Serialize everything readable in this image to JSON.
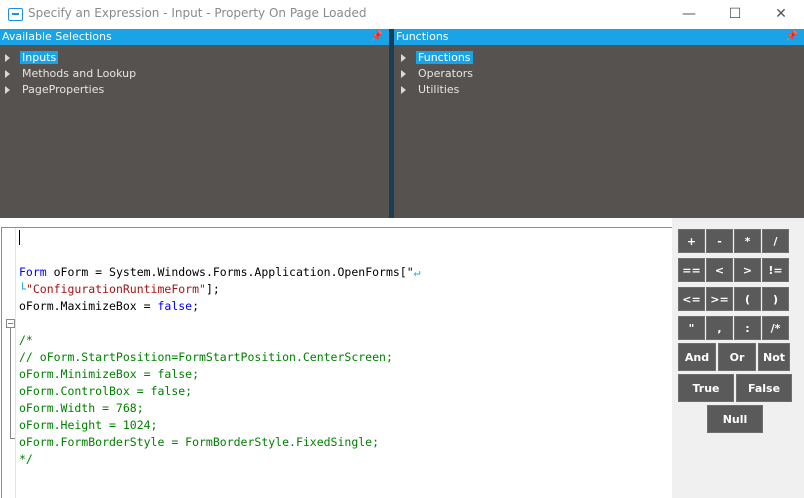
{
  "window": {
    "title": "Specify an Expression - Input  - Property On Page Loaded",
    "minimize_glyph": "—",
    "maximize_glyph": "☐",
    "close_glyph": "✕"
  },
  "left_panel": {
    "header": "Available Selections",
    "pin_glyph": "ᵖ",
    "items": [
      {
        "label": "Inputs",
        "selected": true
      },
      {
        "label": "Methods and Lookup",
        "selected": false
      },
      {
        "label": "PageProperties",
        "selected": false
      }
    ]
  },
  "right_panel": {
    "header": "Functions",
    "pin_glyph": "ᵖ",
    "items": [
      {
        "label": "Functions",
        "selected": true
      },
      {
        "label": "Operators",
        "selected": false
      },
      {
        "label": "Utilities",
        "selected": false
      }
    ]
  },
  "editor": {
    "lines": [
      "",
      "Form oForm = System.Windows.Forms.Application.OpenForms[\"",
      "\"ConfigurationRuntimeForm\"];",
      "oForm.MaximizeBox = false;",
      "",
      "/*",
      "// oForm.StartPosition=FormStartPosition.CenterScreen;",
      "oForm.MinimizeBox = false;",
      "oForm.ControlBox = false;",
      "oForm.Width = 768;",
      "oForm.Height = 1024;",
      "oForm.FormBorderStyle = FormBorderStyle.FixedSingle;",
      "*/"
    ],
    "fold_glyph": "−",
    "wrap_glyph_end": "↵",
    "wrap_glyph_start": "└"
  },
  "keypad": {
    "row1": [
      "+",
      "-",
      "*",
      "/"
    ],
    "row2": [
      "==",
      "<",
      ">",
      "!="
    ],
    "row3": [
      "<=",
      ">=",
      "(",
      ")"
    ],
    "row4": [
      "\"",
      ",",
      ":",
      "/*"
    ],
    "row5": [
      "And",
      "Or",
      "Not"
    ],
    "row6": [
      "True",
      "False"
    ],
    "row7": [
      "Null"
    ]
  },
  "colors": {
    "accent": "#1aa3e6",
    "panel_bg": "#555250",
    "keyword": "#0000ff",
    "string": "#a31515",
    "comment": "#008000",
    "key_bg": "#5a5a5a"
  }
}
